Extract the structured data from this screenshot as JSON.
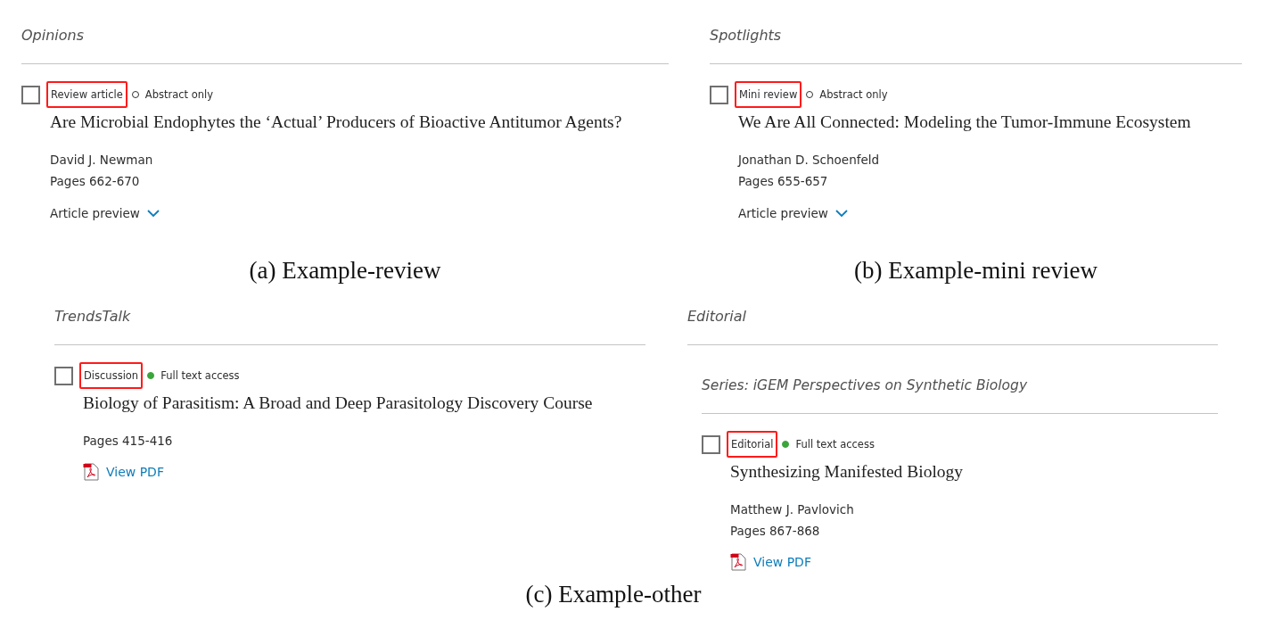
{
  "top_row": [
    {
      "heading": "Opinions",
      "article": {
        "checked": false,
        "type_label": "Review article",
        "highlighted": true,
        "access": {
          "kind": "abstract",
          "label": "Abstract only"
        },
        "title": "Are Microbial Endophytes the ‘Actual’ Producers of Bioactive Antitumor Agents?",
        "authors": "David J. Newman",
        "pages": "Pages 662-670",
        "action": {
          "kind": "preview",
          "label": "Article preview"
        }
      },
      "caption": "(a) Example-review"
    },
    {
      "heading": "Spotlights",
      "article": {
        "checked": false,
        "type_label": "Mini review",
        "highlighted": true,
        "access": {
          "kind": "abstract",
          "label": "Abstract only"
        },
        "title": "We Are All Connected: Modeling the Tumor-Immune Ecosystem",
        "authors": "Jonathan D. Schoenfeld",
        "pages": "Pages 655-657",
        "action": {
          "kind": "preview",
          "label": "Article preview"
        }
      },
      "caption": "(b) Example-mini review"
    }
  ],
  "bottom_row": [
    {
      "heading": "TrendsTalk",
      "article": {
        "checked": false,
        "type_label": "Discussion",
        "highlighted": true,
        "access": {
          "kind": "full",
          "label": "Full text access"
        },
        "title": "Biology of Parasitism: A Broad and Deep Parasitology Discovery Course",
        "pages": "Pages 415-416",
        "action": {
          "kind": "pdf",
          "label": "View PDF"
        }
      }
    },
    {
      "heading": "Editorial",
      "series": "Series: iGEM Perspectives on Synthetic Biology",
      "article": {
        "checked": false,
        "type_label": "Editorial",
        "highlighted": true,
        "access": {
          "kind": "full",
          "label": "Full text access"
        },
        "title": "Synthesizing Manifested Biology",
        "authors": "Matthew J. Pavlovich",
        "pages": "Pages 867-868",
        "action": {
          "kind": "pdf",
          "label": "View PDF"
        }
      }
    }
  ],
  "caption": "(c) Example-other"
}
